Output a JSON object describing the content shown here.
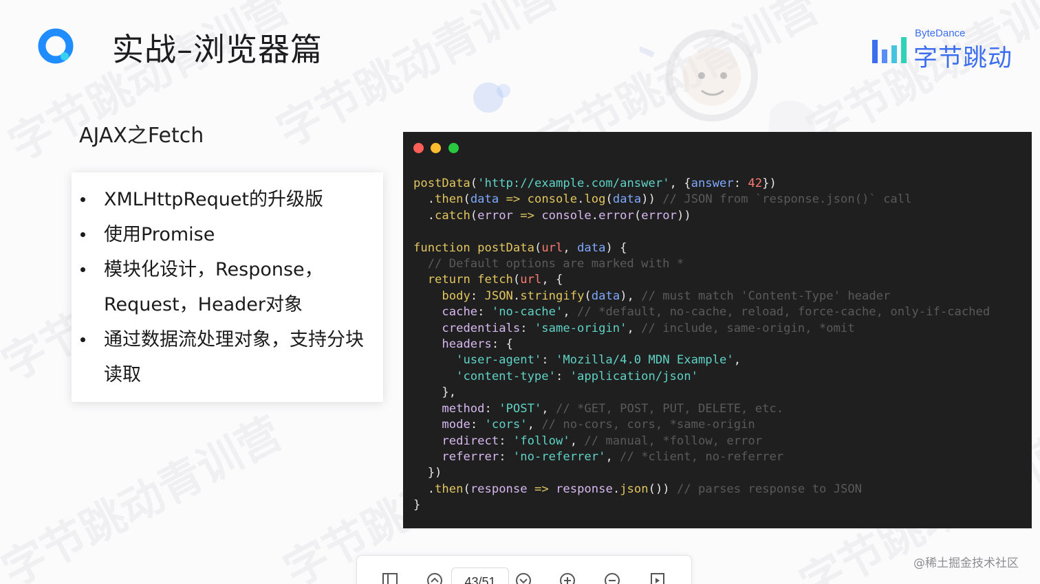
{
  "slide": {
    "title": "实战–浏览器篇",
    "subtitle": "AJAX之Fetch",
    "watermark_text": "字节跳动青训营",
    "brand": {
      "en": "ByteDance",
      "cn": "字节跳动",
      "color": "#3c6ef0"
    },
    "bullets": [
      "XMLHttpRequet的升级版",
      "使用Promise",
      "模块化设计，Response，Request，Header对象",
      "通过数据流处理对象，支持分块读取"
    ]
  },
  "code_window": {
    "lines": [
      [
        [
          "fn",
          "postData"
        ],
        [
          "pl",
          "("
        ],
        [
          "st",
          "'http://example.com/answer'"
        ],
        [
          "pl",
          ", {"
        ],
        [
          "pm",
          "answer"
        ],
        [
          "pl",
          ": "
        ],
        [
          "nm",
          "42"
        ],
        [
          "pl",
          "})"
        ]
      ],
      [
        [
          "pl",
          "  ."
        ],
        [
          "fn",
          "then"
        ],
        [
          "pl",
          "("
        ],
        [
          "pm",
          "data"
        ],
        [
          "pl",
          " "
        ],
        [
          "kw",
          "=>"
        ],
        [
          "pl",
          " "
        ],
        [
          "fn",
          "console"
        ],
        [
          "pl",
          "."
        ],
        [
          "fn",
          "log"
        ],
        [
          "pl",
          "("
        ],
        [
          "pm",
          "data"
        ],
        [
          "pl",
          "))"
        ],
        [
          "cm",
          " // JSON from `response.json()` call"
        ]
      ],
      [
        [
          "pl",
          "  ."
        ],
        [
          "fn",
          "catch"
        ],
        [
          "pl",
          "("
        ],
        [
          "pr",
          "error"
        ],
        [
          "pl",
          " "
        ],
        [
          "kw",
          "=>"
        ],
        [
          "pl",
          " "
        ],
        [
          "pr",
          "console"
        ],
        [
          "pl",
          "."
        ],
        [
          "pr",
          "error"
        ],
        [
          "pl",
          "("
        ],
        [
          "pr",
          "error"
        ],
        [
          "pl",
          "))"
        ]
      ],
      [
        [
          "pl",
          ""
        ]
      ],
      [
        [
          "fn",
          "function"
        ],
        [
          "pl",
          " "
        ],
        [
          "fn",
          "postData"
        ],
        [
          "pl",
          "("
        ],
        [
          "vr",
          "url"
        ],
        [
          "pl",
          ", "
        ],
        [
          "pm",
          "data"
        ],
        [
          "pl",
          ") {"
        ]
      ],
      [
        [
          "cm",
          "  // Default options are marked with *"
        ]
      ],
      [
        [
          "pl",
          "  "
        ],
        [
          "kw",
          "return"
        ],
        [
          "pl",
          " "
        ],
        [
          "fn",
          "fetch"
        ],
        [
          "pl",
          "("
        ],
        [
          "vr",
          "url"
        ],
        [
          "pl",
          ", {"
        ]
      ],
      [
        [
          "pl",
          "    "
        ],
        [
          "fn",
          "body"
        ],
        [
          "pl",
          ": "
        ],
        [
          "fn",
          "JSON"
        ],
        [
          "pl",
          "."
        ],
        [
          "fn",
          "stringify"
        ],
        [
          "pl",
          "("
        ],
        [
          "pm",
          "data"
        ],
        [
          "pl",
          "),"
        ],
        [
          "cm",
          " // must match 'Content-Type' header"
        ]
      ],
      [
        [
          "pl",
          "    "
        ],
        [
          "pr",
          "cache"
        ],
        [
          "pl",
          ": "
        ],
        [
          "st",
          "'no-cache'"
        ],
        [
          "pl",
          ","
        ],
        [
          "cm",
          " // *default, no-cache, reload, force-cache, only-if-cached"
        ]
      ],
      [
        [
          "pl",
          "    "
        ],
        [
          "pr",
          "credentials"
        ],
        [
          "pl",
          ": "
        ],
        [
          "st",
          "'same-origin'"
        ],
        [
          "pl",
          ","
        ],
        [
          "cm",
          " // include, same-origin, *omit"
        ]
      ],
      [
        [
          "pl",
          "    "
        ],
        [
          "pr",
          "headers"
        ],
        [
          "pl",
          ": {"
        ]
      ],
      [
        [
          "pl",
          "      "
        ],
        [
          "st",
          "'user-agent'"
        ],
        [
          "pl",
          ": "
        ],
        [
          "st",
          "'Mozilla/4.0 MDN Example'"
        ],
        [
          "pl",
          ","
        ]
      ],
      [
        [
          "pl",
          "      "
        ],
        [
          "st",
          "'content-type'"
        ],
        [
          "pl",
          ": "
        ],
        [
          "st",
          "'application/json'"
        ]
      ],
      [
        [
          "pl",
          "    },"
        ]
      ],
      [
        [
          "pl",
          "    "
        ],
        [
          "pr",
          "method"
        ],
        [
          "pl",
          ": "
        ],
        [
          "st",
          "'POST'"
        ],
        [
          "pl",
          ","
        ],
        [
          "cm",
          " // *GET, POST, PUT, DELETE, etc."
        ]
      ],
      [
        [
          "pl",
          "    "
        ],
        [
          "pr",
          "mode"
        ],
        [
          "pl",
          ": "
        ],
        [
          "st",
          "'cors'"
        ],
        [
          "pl",
          ","
        ],
        [
          "cm",
          " // no-cors, cors, *same-origin"
        ]
      ],
      [
        [
          "pl",
          "    "
        ],
        [
          "pr",
          "redirect"
        ],
        [
          "pl",
          ": "
        ],
        [
          "st",
          "'follow'"
        ],
        [
          "pl",
          ","
        ],
        [
          "cm",
          " // manual, *follow, error"
        ]
      ],
      [
        [
          "pl",
          "    "
        ],
        [
          "pr",
          "referrer"
        ],
        [
          "pl",
          ": "
        ],
        [
          "st",
          "'no-referrer'"
        ],
        [
          "pl",
          ","
        ],
        [
          "cm",
          " // *client, no-referrer"
        ]
      ],
      [
        [
          "pl",
          "  })"
        ]
      ],
      [
        [
          "pl",
          "  ."
        ],
        [
          "fn",
          "then"
        ],
        [
          "pl",
          "("
        ],
        [
          "pr",
          "response"
        ],
        [
          "pl",
          " "
        ],
        [
          "kw",
          "=>"
        ],
        [
          "pl",
          " "
        ],
        [
          "pr",
          "response"
        ],
        [
          "pl",
          "."
        ],
        [
          "fn",
          "json"
        ],
        [
          "pl",
          "())"
        ],
        [
          "cm",
          " // parses response to JSON"
        ]
      ],
      [
        [
          "pl",
          "}"
        ]
      ]
    ]
  },
  "toolbar": {
    "page_indicator": "43/51",
    "icons": [
      "sidebar-icon",
      "prev-page-icon",
      "next-page-icon",
      "zoom-in-icon",
      "zoom-out-icon",
      "fullscreen-icon"
    ]
  },
  "credit": "@稀土掘金技术社区"
}
